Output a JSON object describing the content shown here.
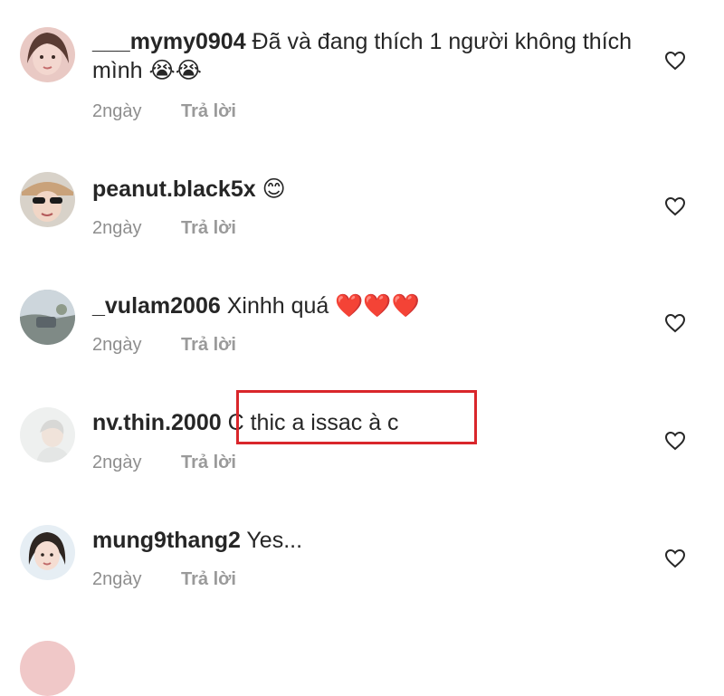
{
  "comments": [
    {
      "username": "___mymy0904",
      "text": "Đã và đang thích 1 người không thích mình",
      "emoji": "😭😭",
      "time": "2ngày",
      "reply": "Trả lời"
    },
    {
      "username": "peanut.black5x",
      "text": "",
      "emoji": "😊",
      "time": "2ngày",
      "reply": "Trả lời"
    },
    {
      "username": "_vulam2006",
      "text": "Xinhh quá",
      "emoji": "❤️❤️❤️",
      "time": "2ngày",
      "reply": "Trả lời"
    },
    {
      "username": "nv.thin.2000",
      "text": "C thic a issac à c",
      "emoji": "",
      "time": "2ngày",
      "reply": "Trả lời"
    },
    {
      "username": "mung9thang2",
      "text": "Yes...",
      "emoji": "",
      "time": "2ngày",
      "reply": "Trả lời"
    }
  ],
  "colors": {
    "highlight": "#d9262b",
    "meta": "#8e8e8e",
    "text": "#262626"
  }
}
